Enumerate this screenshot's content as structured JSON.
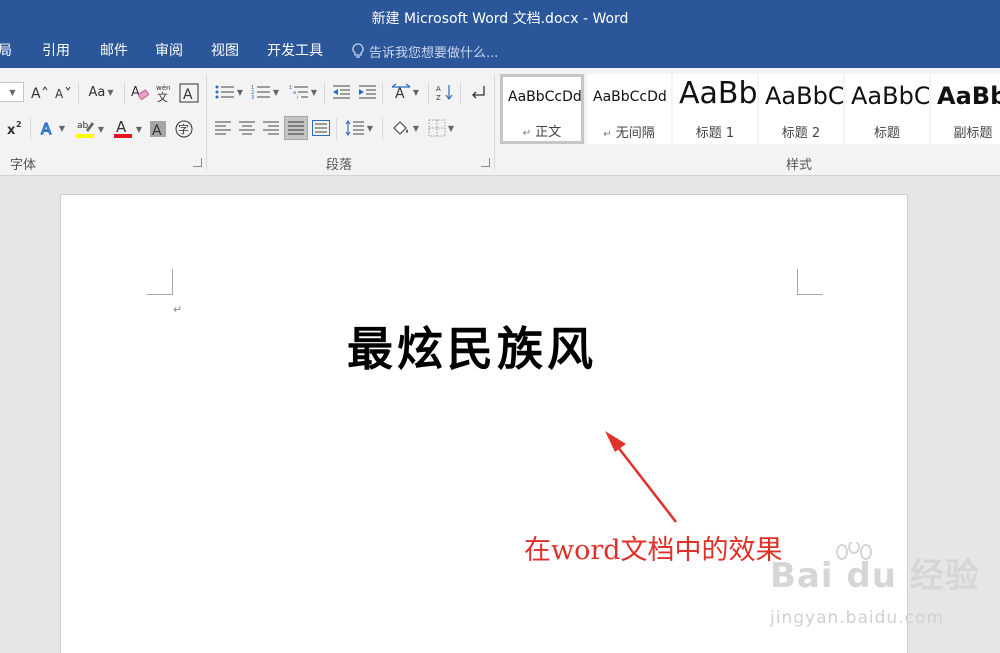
{
  "window": {
    "title": "新建 Microsoft Word 文档.docx - Word"
  },
  "tabs": [
    {
      "label": "局"
    },
    {
      "label": "引用"
    },
    {
      "label": "邮件"
    },
    {
      "label": "审阅"
    },
    {
      "label": "视图"
    },
    {
      "label": "开发工具"
    }
  ],
  "tellme": {
    "placeholder": "告诉我您想要做什么..."
  },
  "ribbon": {
    "font_group": {
      "label": "字体",
      "change_case_label": "Aa",
      "font_color": "#e81123",
      "highlight_color": "#ffff00"
    },
    "paragraph_group": {
      "label": "段落"
    },
    "styles_group": {
      "label": "样式",
      "styles": [
        {
          "sample": "AaBbCcDd",
          "name": "正文",
          "mark": "↵"
        },
        {
          "sample": "AaBbCcDd",
          "name": "无间隔",
          "mark": "↵"
        },
        {
          "sample": "AaBb",
          "name": "标题 1",
          "mark": ""
        },
        {
          "sample": "AaBbC",
          "name": "标题 2",
          "mark": ""
        },
        {
          "sample": "AaBbC",
          "name": "标题",
          "mark": ""
        },
        {
          "sample": "AaBbC",
          "name": "副标题",
          "mark": ""
        }
      ]
    }
  },
  "document": {
    "heading": "最炫民族风",
    "paragraph_mark": "↵"
  },
  "annotation": {
    "text": "在word文档中的效果",
    "color": "#e0302a"
  },
  "watermark": {
    "logo": "Bai du 经验",
    "url": "jingyan.baidu.com"
  },
  "colors": {
    "titlebar": "#2b579a",
    "ribbon": "#f3f3f3",
    "canvas": "#e6e6e6"
  }
}
